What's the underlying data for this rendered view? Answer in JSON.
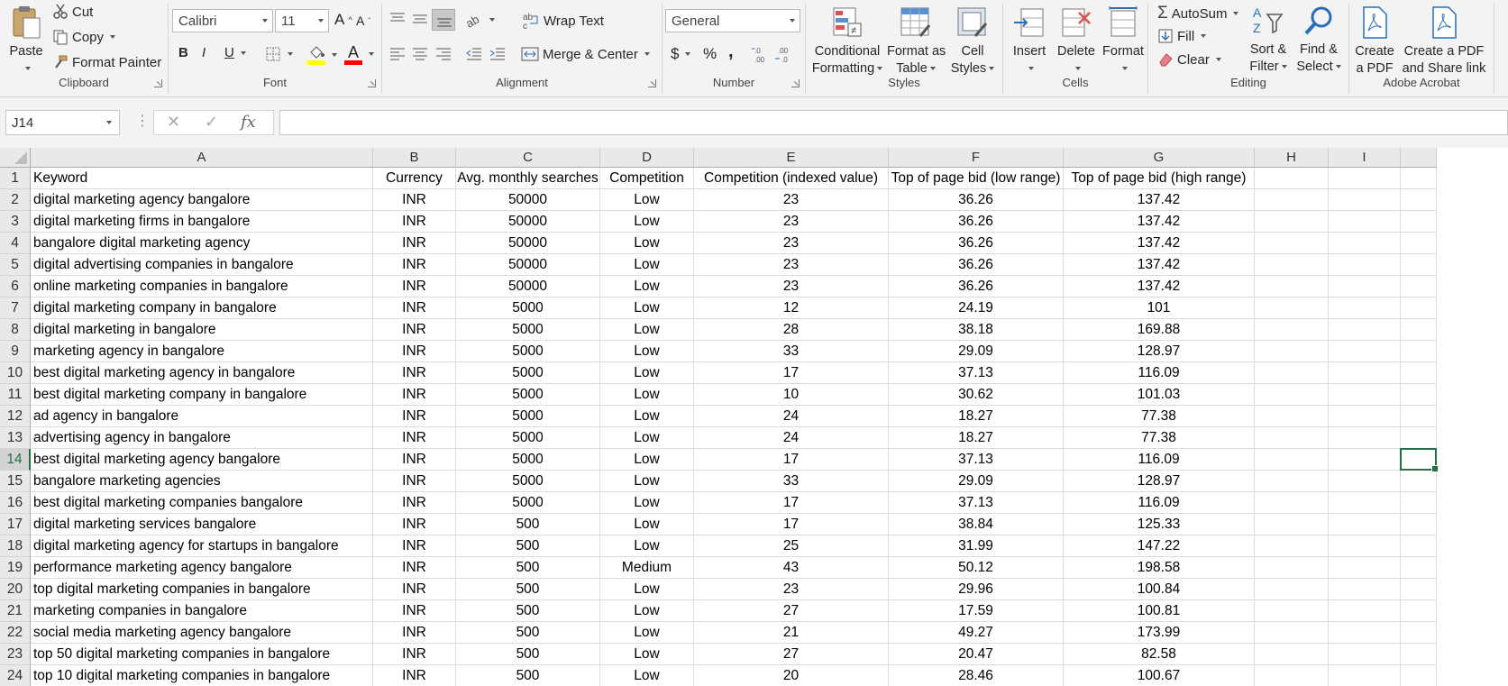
{
  "ribbon": {
    "clipboard": {
      "label": "Clipboard",
      "paste": "Paste",
      "cut": "Cut",
      "copy": "Copy",
      "format_painter": "Format Painter"
    },
    "font": {
      "label": "Font",
      "font_name": "Calibri",
      "font_size": "11",
      "bold": "B",
      "italic": "I",
      "underline": "U",
      "grow": "A",
      "shrink": "A",
      "font_color_letter": "A",
      "fill_color": "#ffff00",
      "font_color": "#ff0000"
    },
    "alignment": {
      "label": "Alignment",
      "wrap_text": "Wrap Text",
      "merge_center": "Merge & Center"
    },
    "number": {
      "label": "Number",
      "format": "General",
      "currency": "$",
      "percent": "%",
      "comma": ","
    },
    "styles": {
      "label": "Styles",
      "conditional": [
        "Conditional",
        "Formatting"
      ],
      "format_table": [
        "Format as",
        "Table"
      ],
      "cell_styles": [
        "Cell",
        "Styles"
      ]
    },
    "cells": {
      "label": "Cells",
      "insert": "Insert",
      "delete": "Delete",
      "format": "Format"
    },
    "editing": {
      "label": "Editing",
      "autosum": "AutoSum",
      "fill": "Fill",
      "clear": "Clear",
      "sort_filter": [
        "Sort &",
        "Filter"
      ],
      "find_select": [
        "Find &",
        "Select"
      ]
    },
    "acrobat": {
      "label": "Adobe Acrobat",
      "create_pdf": [
        "Create",
        "a PDF"
      ],
      "create_share": [
        "Create a PDF",
        "and Share link"
      ]
    }
  },
  "formula_bar": {
    "name_box": "J14",
    "formula": ""
  },
  "sheet": {
    "columns": [
      "A",
      "B",
      "C",
      "D",
      "E",
      "F",
      "G",
      "H",
      "I"
    ],
    "selected_cell": "J14",
    "selected_row": 14,
    "header": [
      "Keyword",
      "Currency",
      "Avg. monthly searches",
      "Competition",
      "Competition (indexed value)",
      "Top of page bid (low range)",
      "Top of page bid (high range)"
    ],
    "rows": [
      [
        "digital marketing agency bangalore",
        "INR",
        "50000",
        "Low",
        "23",
        "36.26",
        "137.42"
      ],
      [
        "digital marketing firms in bangalore",
        "INR",
        "50000",
        "Low",
        "23",
        "36.26",
        "137.42"
      ],
      [
        "bangalore digital marketing agency",
        "INR",
        "50000",
        "Low",
        "23",
        "36.26",
        "137.42"
      ],
      [
        "digital advertising companies in bangalore",
        "INR",
        "50000",
        "Low",
        "23",
        "36.26",
        "137.42"
      ],
      [
        "online marketing companies in bangalore",
        "INR",
        "50000",
        "Low",
        "23",
        "36.26",
        "137.42"
      ],
      [
        "digital marketing company in bangalore",
        "INR",
        "5000",
        "Low",
        "12",
        "24.19",
        "101"
      ],
      [
        "digital marketing in bangalore",
        "INR",
        "5000",
        "Low",
        "28",
        "38.18",
        "169.88"
      ],
      [
        "marketing agency in bangalore",
        "INR",
        "5000",
        "Low",
        "33",
        "29.09",
        "128.97"
      ],
      [
        "best digital marketing agency in bangalore",
        "INR",
        "5000",
        "Low",
        "17",
        "37.13",
        "116.09"
      ],
      [
        "best digital marketing company in bangalore",
        "INR",
        "5000",
        "Low",
        "10",
        "30.62",
        "101.03"
      ],
      [
        "ad agency in bangalore",
        "INR",
        "5000",
        "Low",
        "24",
        "18.27",
        "77.38"
      ],
      [
        "advertising agency in bangalore",
        "INR",
        "5000",
        "Low",
        "24",
        "18.27",
        "77.38"
      ],
      [
        "best digital marketing agency bangalore",
        "INR",
        "5000",
        "Low",
        "17",
        "37.13",
        "116.09"
      ],
      [
        "bangalore marketing agencies",
        "INR",
        "5000",
        "Low",
        "33",
        "29.09",
        "128.97"
      ],
      [
        "best digital marketing companies bangalore",
        "INR",
        "5000",
        "Low",
        "17",
        "37.13",
        "116.09"
      ],
      [
        "digital marketing services bangalore",
        "INR",
        "500",
        "Low",
        "17",
        "38.84",
        "125.33"
      ],
      [
        "digital marketing agency for startups in bangalore",
        "INR",
        "500",
        "Low",
        "25",
        "31.99",
        "147.22"
      ],
      [
        "performance marketing agency bangalore",
        "INR",
        "500",
        "Medium",
        "43",
        "50.12",
        "198.58"
      ],
      [
        "top digital marketing companies in bangalore",
        "INR",
        "500",
        "Low",
        "23",
        "29.96",
        "100.84"
      ],
      [
        "marketing companies in bangalore",
        "INR",
        "500",
        "Low",
        "27",
        "17.59",
        "100.81"
      ],
      [
        "social media marketing agency bangalore",
        "INR",
        "500",
        "Low",
        "21",
        "49.27",
        "173.99"
      ],
      [
        "top 50 digital marketing companies in bangalore",
        "INR",
        "500",
        "Low",
        "27",
        "20.47",
        "82.58"
      ],
      [
        "top 10 digital marketing companies in bangalore",
        "INR",
        "500",
        "Low",
        "20",
        "28.46",
        "100.67"
      ]
    ]
  }
}
